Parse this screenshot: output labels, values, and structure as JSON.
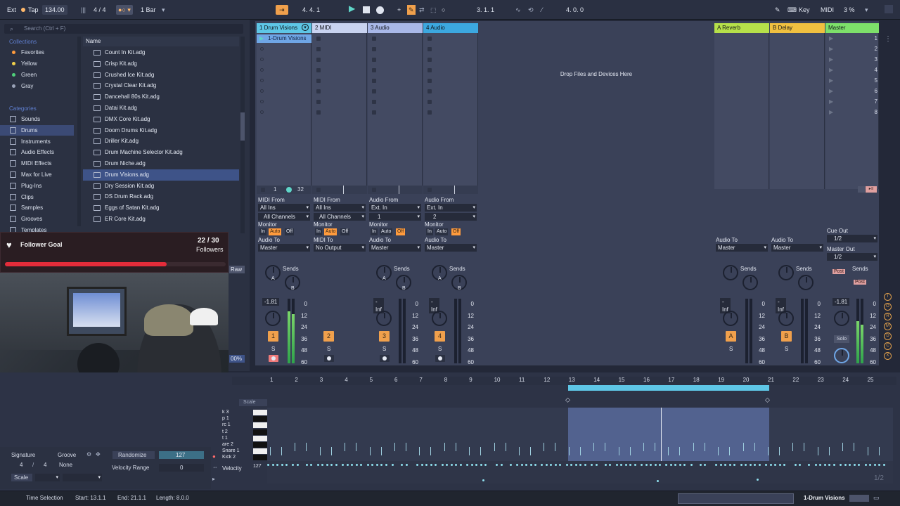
{
  "transport": {
    "ext": "Ext",
    "tap": "Tap",
    "tempo": "134.00",
    "signature": "4 / 4",
    "quant": "1 Bar",
    "position": "4.   4.   1",
    "loop_start": "3.   1.   1",
    "loop_length": "4.   0.   0",
    "key": "Key",
    "midi": "MIDI",
    "cpu": "3 %"
  },
  "browser": {
    "search_placeholder": "Search (Ctrl + F)",
    "collections_heading": "Collections",
    "collections": [
      {
        "label": "Favorites",
        "color": "#ff9b3d"
      },
      {
        "label": "Yellow",
        "color": "#f0d04a"
      },
      {
        "label": "Green",
        "color": "#4fd07a"
      },
      {
        "label": "Gray",
        "color": "#9aa3b8"
      }
    ],
    "categories_heading": "Categories",
    "categories": [
      "Sounds",
      "Drums",
      "Instruments",
      "Audio Effects",
      "MIDI Effects",
      "Max for Live",
      "Plug-Ins",
      "Clips",
      "Samples",
      "Grooves",
      "Templates"
    ],
    "selected_category": "Drums",
    "name_header": "Name",
    "files": [
      "Count In Kit.adg",
      "Crisp Kit.adg",
      "Crushed Ice Kit.adg",
      "Crystal Clear Kit.adg",
      "Dancehall 80s Kit.adg",
      "Datai Kit.adg",
      "DMX Core Kit.adg",
      "Doom Drums Kit.adg",
      "Driller Kit.adg",
      "Drum Machine Selector Kit.adg",
      "Drum Niche.adg",
      "Drum Visions.adg",
      "Dry Session Kit.adg",
      "DS Drum Rack.adg",
      "Eggs of Satan Kit.adg",
      "ER Core Kit.adg"
    ],
    "selected_file": "Drum Visions.adg",
    "raw_label": "Raw",
    "zoom_label": "00%"
  },
  "tracks": [
    {
      "name": "1 Drum Visions",
      "color": "#5ec6e6",
      "clip": "1-Drum Visions",
      "from_label": "MIDI From",
      "from": "All Ins",
      "ch": "All Channels",
      "to": "Master",
      "volume": "-1.81",
      "num": "1",
      "to_label": "Audio To"
    },
    {
      "name": "2 MIDI",
      "color": "#c9d3f0",
      "clip": "",
      "from_label": "MIDI From",
      "from": "All Ins",
      "ch": "All Channels",
      "to": "No Output",
      "volume": "",
      "num": "2",
      "to_label": "MIDI To"
    },
    {
      "name": "3 Audio",
      "color": "#a9b8e8",
      "clip": "",
      "from_label": "Audio From",
      "from": "Ext. In",
      "ch": "1",
      "to": "Master",
      "volume": "-Inf",
      "num": "3",
      "to_label": "Audio To"
    },
    {
      "name": "4 Audio",
      "color": "#3ca8e0",
      "clip": "",
      "from_label": "Audio From",
      "from": "Ext. In",
      "ch": "2",
      "to": "Master",
      "volume": "-Inf",
      "num": "4",
      "to_label": "Audio To"
    }
  ],
  "returns": [
    {
      "name": "A Reverb",
      "color": "#b6e04a",
      "to": "Master",
      "volume": "-Inf",
      "letter": "A"
    },
    {
      "name": "B Delay",
      "color": "#f0c040",
      "to": "Master",
      "volume": "-Inf",
      "letter": "B"
    }
  ],
  "master": {
    "name": "Master",
    "color": "#7de06a",
    "cue_label": "Cue Out",
    "cue": "1/2",
    "out_label": "Master Out",
    "out": "1/2",
    "volume": "-1.81",
    "solo": "Solo",
    "post": "Post"
  },
  "scene_numbers": [
    "1",
    "2",
    "3",
    "4",
    "5",
    "6",
    "7",
    "8"
  ],
  "drop_text": "Drop Files and Devices Here",
  "monitor": {
    "label": "Monitor",
    "in": "In",
    "auto": "Auto",
    "off": "Off"
  },
  "sends_label": "Sends",
  "meter_scale": [
    "0",
    "12",
    "24",
    "36",
    "48",
    "60"
  ],
  "scene_bar": {
    "a": "1",
    "b": "32"
  },
  "follower": {
    "title": "Follower Goal",
    "count": "22 / 30",
    "unit": "Followers",
    "progress": 0.733
  },
  "detail": {
    "ruler": [
      "1",
      "2",
      "3",
      "4",
      "5",
      "6",
      "7",
      "8",
      "9",
      "10",
      "11",
      "12",
      "13",
      "14",
      "15",
      "16",
      "17",
      "18",
      "19",
      "20",
      "21",
      "22",
      "23",
      "24",
      "25"
    ],
    "scale_btn": "Scale",
    "lanes": [
      "k 3",
      "p 1",
      "rc 1",
      "t 2",
      "t 1",
      "are 2",
      "Snare 1",
      "Kick 2"
    ],
    "velocity": "Velocity",
    "vel_value": "127",
    "signature_label": "Signature",
    "groove_label": "Groove",
    "sig_num": "4",
    "sig_den": "4",
    "groove": "None",
    "scale_label": "Scale",
    "randomize": "Randomize",
    "rand_value": "127",
    "vel_range": "Velocity Range",
    "vel_range_value": "0",
    "page": "1/2"
  },
  "status": {
    "mode": "Time Selection",
    "start": "Start: 13.1.1",
    "end": "End: 21.1.1",
    "length": "Length: 8.0.0",
    "clip": "1-Drum Visions"
  }
}
